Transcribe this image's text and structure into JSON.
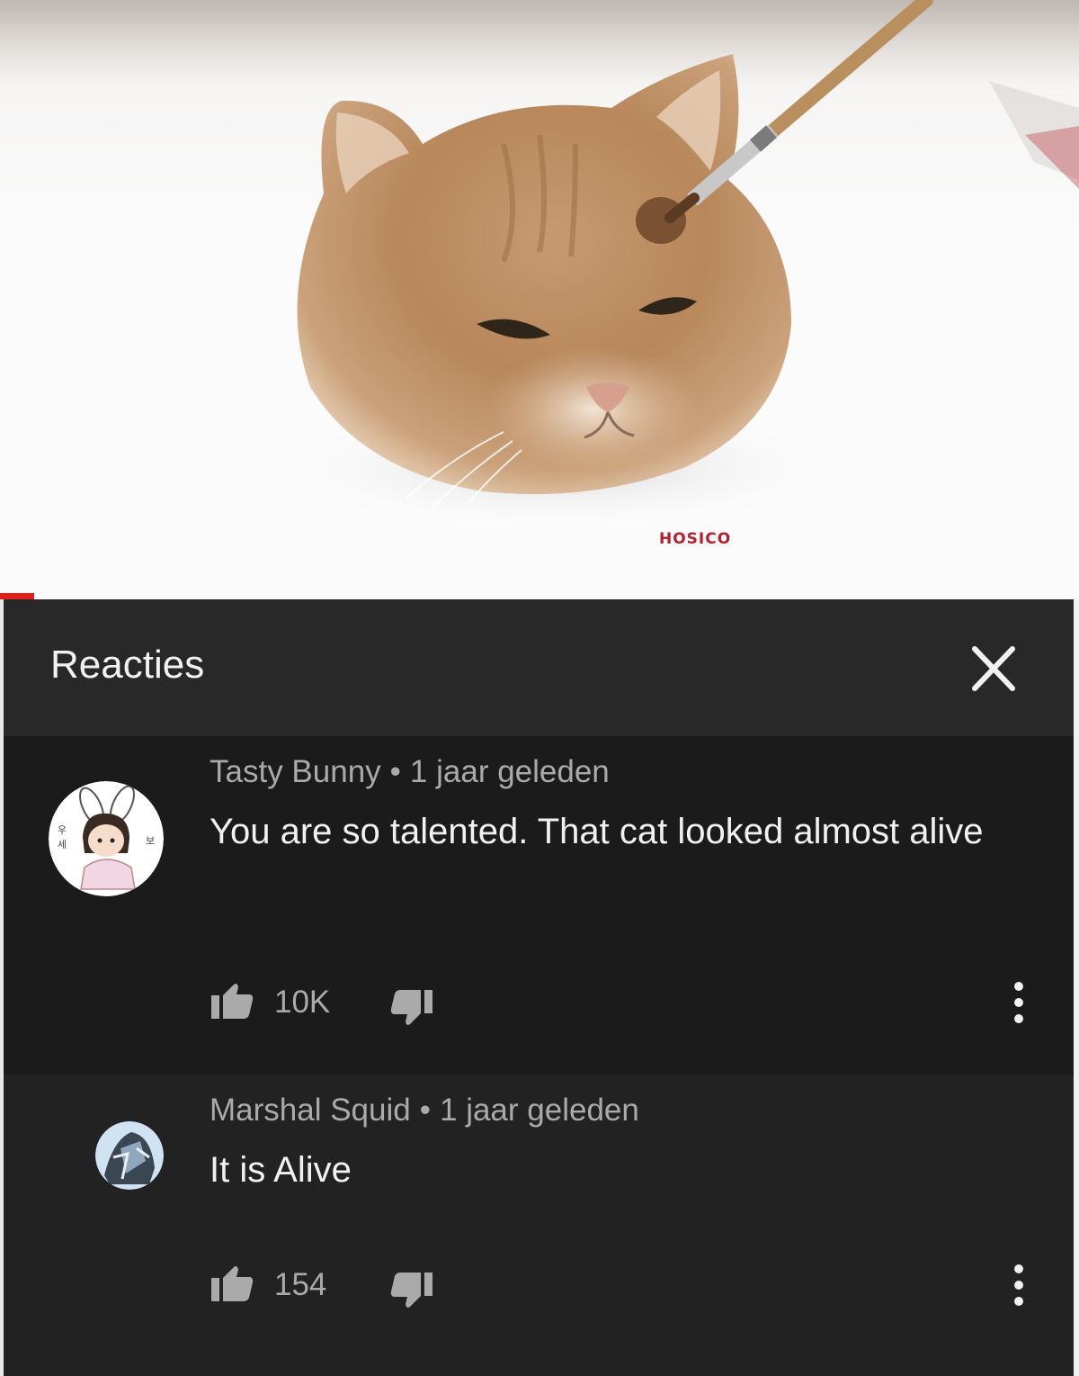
{
  "video": {
    "watermark": "HOSICO",
    "progress_fraction": 0.03,
    "colors": {
      "accent_red": "#e0201b",
      "watermark": "#b3202f"
    }
  },
  "panel": {
    "title": "Reacties",
    "close_icon": "close-icon"
  },
  "comments": [
    {
      "author": "Tasty Bunny",
      "time": "1 jaar geleden",
      "text": "You are so talented. That cat looked almost alive",
      "likes": "10K",
      "avatar_icon": "anime-bunny-girl-avatar"
    },
    {
      "author": "Marshal Squid",
      "time": "1 jaar geleden",
      "text": "It is Alive",
      "likes": "154",
      "avatar_icon": "anime-character-avatar"
    }
  ],
  "dot_separator": "•",
  "colors": {
    "panel_bg": "#1b1b1b",
    "header_bg": "#282828",
    "reply_bg": "#222222",
    "primary_text": "#f1f1f1",
    "secondary_text": "#aaaaaa"
  }
}
